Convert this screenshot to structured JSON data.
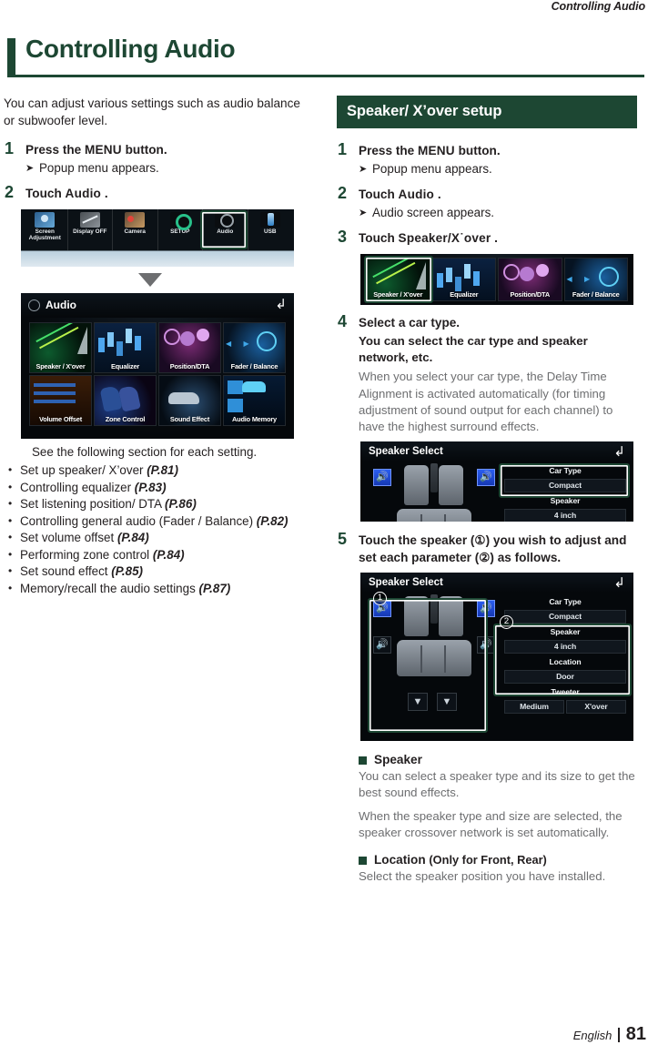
{
  "running_head": "Controlling Audio",
  "chapter_title": "Controlling Audio",
  "accent_color": "#1d4733",
  "left": {
    "lead": "You can adjust various settings such as audio balance or subwoofer level.",
    "step1": {
      "num": "1",
      "head_pre": "Press the ",
      "head_kw": "MENU",
      "head_post": " button.",
      "sub": "Popup menu appears."
    },
    "step2": {
      "num": "2",
      "head_pre": "Touch ",
      "head_kw": "Audio",
      "head_post": " ."
    },
    "popup_shot": {
      "items": [
        {
          "label": "Screen Adjustment",
          "icon": "screen-adjustment-icon"
        },
        {
          "label": "Display OFF",
          "icon": "display-off-icon"
        },
        {
          "label": "Camera",
          "icon": "camera-icon"
        },
        {
          "label": "SETUP",
          "icon": "setup-gear-icon"
        },
        {
          "label": "Audio",
          "icon": "audio-icon"
        },
        {
          "label": "USB",
          "icon": "usb-icon"
        }
      ],
      "highlighted": "Audio"
    },
    "audio_shot": {
      "title": "Audio",
      "back_icon": "back-arrow-icon",
      "tiles": [
        "Speaker / X'over",
        "Equalizer",
        "Position/DTA",
        "Fader / Balance",
        "Volume Offset",
        "Zone Control",
        "Sound Effect",
        "Audio Memory"
      ]
    },
    "see_also": "See the following section for each setting.",
    "reflist": [
      {
        "text": "Set up speaker/ X’over ",
        "page": "(P.81)"
      },
      {
        "text": "Controlling equalizer ",
        "page": "(P.83)"
      },
      {
        "text": "Set listening position/ DTA ",
        "page": "(P.86)"
      },
      {
        "text": "Controlling general audio (Fader / Balance) ",
        "page": "(P.82)"
      },
      {
        "text": "Set volume offset ",
        "page": "(P.84)"
      },
      {
        "text": "Performing zone control ",
        "page": "(P.84)"
      },
      {
        "text": "Set sound effect ",
        "page": "(P.85)"
      },
      {
        "text": "Memory/recall the audio settings ",
        "page": "(P.87)"
      }
    ]
  },
  "right": {
    "banner": "Speaker/ X’over setup",
    "step1": {
      "num": "1",
      "head_pre": "Press the ",
      "head_kw": "MENU",
      "head_post": " button.",
      "sub": "Popup menu appears."
    },
    "step2": {
      "num": "2",
      "head_pre": "Touch ",
      "head_kw": "Audio",
      "head_post": " .",
      "sub": "Audio screen appears."
    },
    "step3": {
      "num": "3",
      "head_pre": "Touch ",
      "head_kw": "Speaker/X˙over",
      "head_post": " ."
    },
    "audio_tiles_shot": {
      "tiles": [
        "Speaker / X'over",
        "Equalizer",
        "Position/DTA",
        "Fader / Balance"
      ],
      "highlighted": "Speaker / X'over"
    },
    "step4": {
      "num": "4",
      "head": "Select a car type.",
      "body": "You can select the car type and speaker network, etc.",
      "note": "When you select your car type, the Delay Time Alignment is activated automatically (for timing adjustment of sound output for each channel) to have the highest surround effects."
    },
    "speaker_select_1": {
      "title": "Speaker Select",
      "back_icon": "back-arrow-icon",
      "rows": [
        {
          "label": "Car Type",
          "value": "Compact",
          "highlighted": true
        },
        {
          "label": "Speaker",
          "value": "4 inch",
          "highlighted": false
        }
      ]
    },
    "step5": {
      "num": "5",
      "head": "Touch the speaker (①) you wish to adjust and set each parameter (②) as follows."
    },
    "speaker_select_2": {
      "title": "Speaker Select",
      "back_icon": "back-arrow-icon",
      "callout_1": "1",
      "callout_2": "2",
      "rows": [
        {
          "label": "Car Type",
          "value": "Compact"
        },
        {
          "label": "Speaker",
          "value": "4 inch"
        },
        {
          "label": "Location",
          "value": "Door"
        },
        {
          "label": "Tweeter",
          "value": "Medium"
        }
      ],
      "xover_button": "X'over"
    },
    "speaker_head": "Speaker",
    "speaker_body_1": "You can select a speaker type and its size to get the best sound effects.",
    "speaker_body_2": "When the speaker type and size are selected, the speaker crossover network is set automatically.",
    "location_head": "Location",
    "location_paren": "(Only for Front, Rear)",
    "location_body": "Select the speaker position you have installed."
  },
  "footer": {
    "language": "English",
    "page": "81"
  }
}
